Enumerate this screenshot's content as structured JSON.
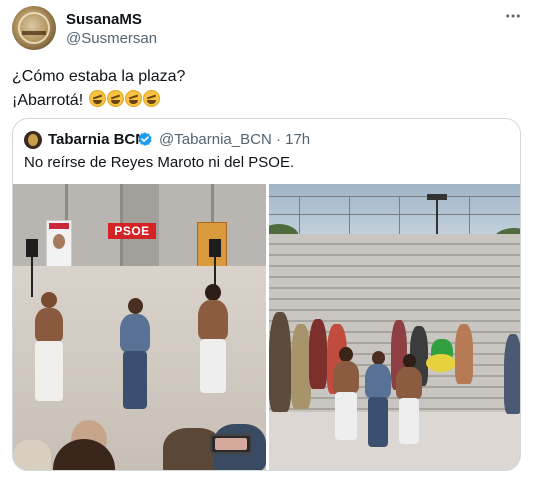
{
  "author": {
    "display_name": "SusanaMS",
    "handle": "@Susmersan",
    "avatar_icon": "profile-avatar"
  },
  "tweet": {
    "line1": "¿Cómo estaba la plaza?",
    "line2": "¡Abarrotá!",
    "emoji_name": "rolling-on-the-floor-laughing",
    "emoji_count": 4
  },
  "quoted": {
    "display_name": "Tabarnia BCN",
    "verified": true,
    "handle": "@Tabarnia_BCN",
    "separator": "·",
    "time": "17h",
    "text": "No reírse de Reyes Maroto ni del PSOE.",
    "media": {
      "left_sign": "PSOE",
      "left_poster_caption": "JUAN LOBATO",
      "pane_count": 2
    }
  },
  "colors": {
    "text_primary": "#0f1419",
    "text_secondary": "#536471",
    "border": "#cfd9de",
    "verified_blue": "#1d9bf0",
    "psoe_red": "#d42327"
  }
}
